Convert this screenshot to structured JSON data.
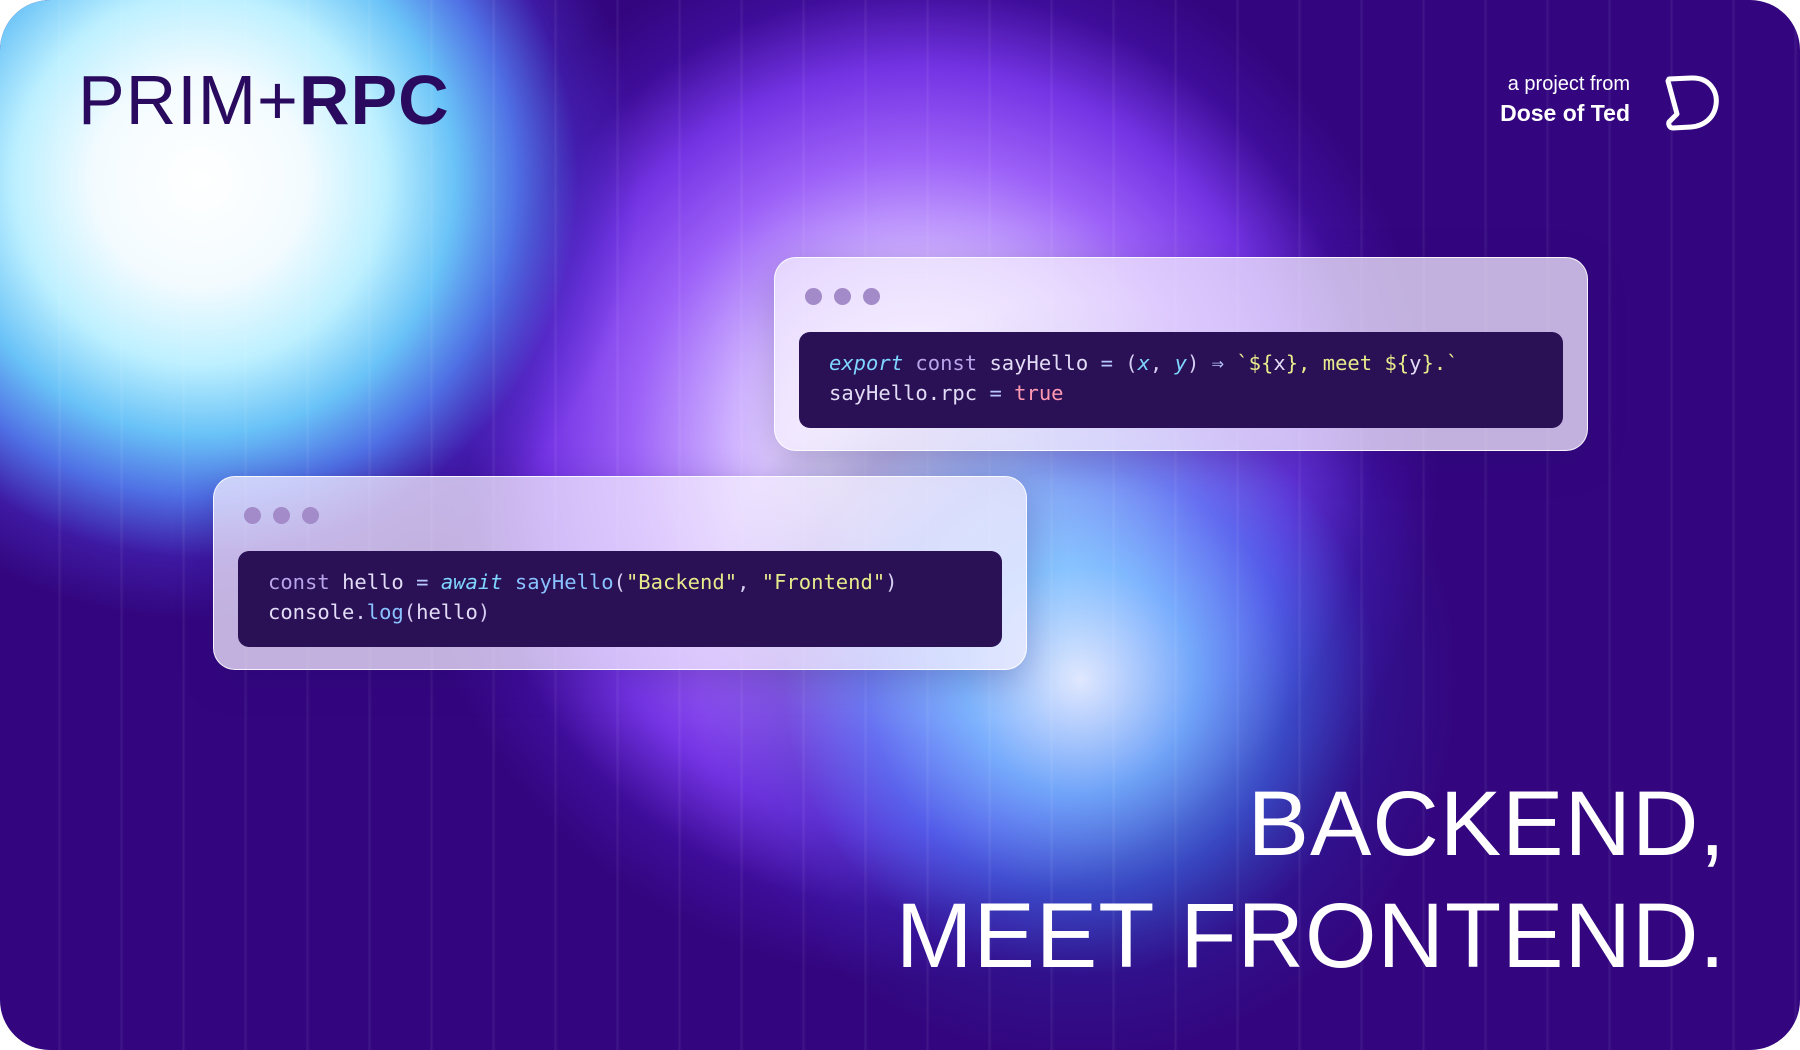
{
  "brand": {
    "name_light": "PRIM+",
    "name_bold": "RPC"
  },
  "credit": {
    "prefix": "a project from",
    "org": "Dose of Ted",
    "logo_icon": "dose-of-ted-logo-icon"
  },
  "code_windows": [
    {
      "lines": [
        [
          {
            "t": "export",
            "c": "kw-i"
          },
          {
            "t": " const ",
            "c": "kw"
          },
          {
            "t": "sayHello ",
            "c": "id"
          },
          {
            "t": "= ",
            "c": "op"
          },
          {
            "t": "(",
            "c": "punc"
          },
          {
            "t": "x",
            "c": "kw-i"
          },
          {
            "t": ", ",
            "c": "punc"
          },
          {
            "t": "y",
            "c": "kw-i"
          },
          {
            "t": ") ",
            "c": "punc"
          },
          {
            "t": "⇒ ",
            "c": "op"
          },
          {
            "t": "`${",
            "c": "str"
          },
          {
            "t": "x",
            "c": "id"
          },
          {
            "t": "}, meet ${",
            "c": "str"
          },
          {
            "t": "y",
            "c": "id"
          },
          {
            "t": "}.`",
            "c": "str"
          }
        ],
        [
          {
            "t": "sayHello.rpc ",
            "c": "id"
          },
          {
            "t": "= ",
            "c": "op"
          },
          {
            "t": "true",
            "c": "bool"
          }
        ]
      ]
    },
    {
      "lines": [
        [
          {
            "t": "const ",
            "c": "kw"
          },
          {
            "t": "hello ",
            "c": "id"
          },
          {
            "t": "= ",
            "c": "op"
          },
          {
            "t": "await ",
            "c": "kw-i"
          },
          {
            "t": "sayHello",
            "c": "fn"
          },
          {
            "t": "(",
            "c": "punc"
          },
          {
            "t": "\"Backend\"",
            "c": "str"
          },
          {
            "t": ", ",
            "c": "punc"
          },
          {
            "t": "\"Frontend\"",
            "c": "str"
          },
          {
            "t": ")",
            "c": "punc"
          }
        ],
        [
          {
            "t": "console",
            "c": "id"
          },
          {
            "t": ".",
            "c": "punc"
          },
          {
            "t": "log",
            "c": "fn"
          },
          {
            "t": "(",
            "c": "punc"
          },
          {
            "t": "hello",
            "c": "id"
          },
          {
            "t": ")",
            "c": "punc"
          }
        ]
      ]
    }
  ],
  "headline": {
    "line1": "BACKEND,",
    "line2": "MEET FRONTEND."
  },
  "colors": {
    "background": "#33067f",
    "logo_text": "#2a0a5e",
    "code_bg": "#2a1055"
  }
}
